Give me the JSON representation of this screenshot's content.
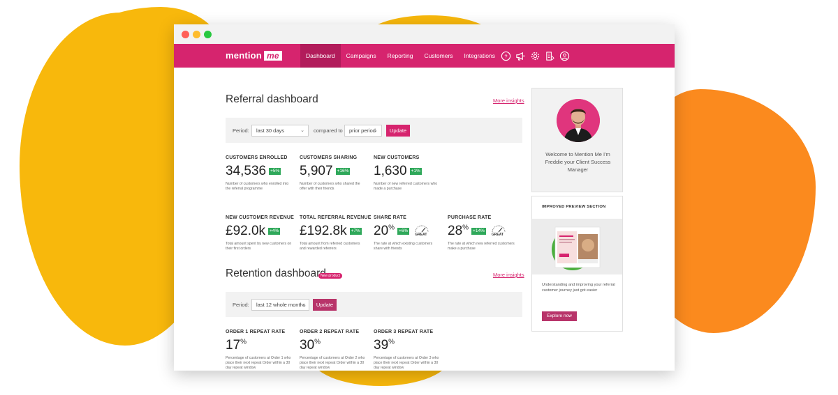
{
  "window": {
    "logo_text": "mention",
    "logo_badge": "me"
  },
  "nav": {
    "items": [
      {
        "label": "Dashboard",
        "active": true
      },
      {
        "label": "Campaigns",
        "active": false
      },
      {
        "label": "Reporting",
        "active": false
      },
      {
        "label": "Customers",
        "active": false
      },
      {
        "label": "Integrations",
        "active": false
      }
    ],
    "icons": [
      "help-icon",
      "megaphone-icon",
      "gear-icon",
      "document-icon",
      "user-icon"
    ]
  },
  "referral": {
    "title": "Referral dashboard",
    "insights_link": "More insights",
    "filter": {
      "period_label": "Period:",
      "period_value": "last 30 days",
      "compared_label": "compared to",
      "compared_value": "prior period",
      "update_label": "Update"
    },
    "metrics": [
      {
        "label": "CUSTOMERS ENROLLED",
        "value": "34,536",
        "suffix": "",
        "badge": "+5%",
        "desc": "Number of customers who enrolled into the referral programme",
        "gauge": ""
      },
      {
        "label": "CUSTOMERS SHARING",
        "value": "5,907",
        "suffix": "",
        "badge": "+16%",
        "desc": "Number of customers who shared the offer with their friends",
        "gauge": ""
      },
      {
        "label": "NEW CUSTOMERS",
        "value": "1,630",
        "suffix": "",
        "badge": "+1%",
        "desc": "Number of new referred customers who made a purchase",
        "gauge": ""
      },
      {
        "label": "NEW CUSTOMER REVENUE",
        "value": "£92.0k",
        "suffix": "",
        "badge": "+4%",
        "desc": "Total amount spent by new customers on their first orders",
        "gauge": ""
      },
      {
        "label": "TOTAL REFERRAL REVENUE",
        "value": "£192.8k",
        "suffix": "",
        "badge": "+7%",
        "desc": "Total amount from referred customers and rewarded referrers",
        "gauge": ""
      },
      {
        "label": "SHARE RATE",
        "value": "20",
        "suffix": "%",
        "badge": "+6%",
        "desc": "The rate at which existing customers share with friends",
        "gauge": "GREAT"
      },
      {
        "label": "PURCHASE RATE",
        "value": "28",
        "suffix": "%",
        "badge": "+14%",
        "desc": "The rate at which new referred customers make a purchase",
        "gauge": "GREAT"
      }
    ]
  },
  "retention": {
    "title": "Retention dashboard",
    "new_badge": "New product",
    "insights_link": "More insights",
    "filter": {
      "period_label": "Period:",
      "period_value": "last 12 whole months",
      "update_label": "Update"
    },
    "metrics": [
      {
        "label": "ORDER 1 REPEAT RATE",
        "value": "17",
        "suffix": "%",
        "desc": "Percentage of customers at Order 1 who place their next repeat Order within a 30 day repeat window"
      },
      {
        "label": "ORDER 2 REPEAT RATE",
        "value": "30",
        "suffix": "%",
        "desc": "Percentage of customers at Order 2 who place their next repeat Order within a 30 day repeat window"
      },
      {
        "label": "ORDER 3 REPEAT RATE",
        "value": "39",
        "suffix": "%",
        "desc": "Percentage of customers at Order 3 who place their next repeat Order within a 30 day repeat window"
      }
    ]
  },
  "sidebar": {
    "welcome": "Welcome to Mention Me I'm Freddie your Client Success Manager",
    "preview_title": "IMPROVED PREVIEW SECTION",
    "preview_text": "Understanding and improving your referral customer journey just got easier",
    "explore_label": "Explore now"
  },
  "colors": {
    "brand": "#D6246E",
    "badge_green": "#2FA85A",
    "blob_yellow": "#F8B80C",
    "blob_orange": "#FB8A1E"
  }
}
